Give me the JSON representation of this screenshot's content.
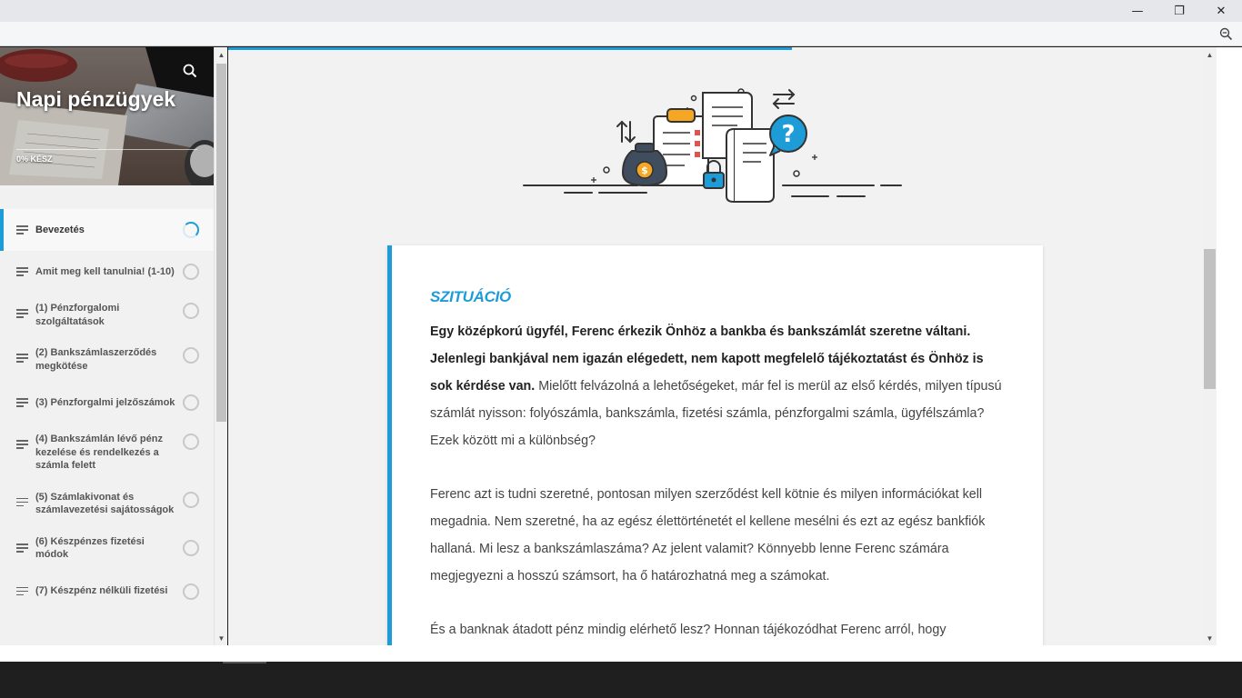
{
  "window": {
    "minimize_glyph": "—",
    "restore_glyph": "❐",
    "close_glyph": "✕"
  },
  "icons": {
    "zoom": "zoom-out-icon",
    "search": "search-icon",
    "menu": "menu-lines-icon"
  },
  "colors": {
    "accent": "#1d9cd8",
    "progress_bar_fraction": 0.57
  },
  "course": {
    "title": "Napi pénzügyek",
    "progress_label": "0% KÉSZ"
  },
  "lessons": [
    {
      "label": "Bevezetés",
      "active": true
    },
    {
      "label": "Amit meg kell tanulnia! (1-10)"
    },
    {
      "label": "(1) Pénzforgalomi szolgáltatások"
    },
    {
      "label": "(2) Bankszámlaszerződés megkötése"
    },
    {
      "label": "(3) Pénzforgalmi jelzőszámok"
    },
    {
      "label": "(4) Bankszámlán lévő pénz kezelése és rendelkezés a számla felett"
    },
    {
      "label": "(5) Számlakivonat és számlavezetési sajátosságok"
    },
    {
      "label": "(6) Készpénzes fizetési módok"
    },
    {
      "label": "(7) Készpénz nélküli fizetési"
    }
  ],
  "content": {
    "heading": "SZITUÁCIÓ",
    "p1_bold": "Egy középkorú ügyfél, Ferenc érkezik Önhöz a bankba és bankszámlát szeretne váltani. Jelenlegi bankjával nem igazán elégedett, nem kapott megfelelő tájékoztatást és Önhöz is sok kérdése van.",
    "p1_rest": " Mielőtt felvázolná a lehetőségeket, már fel is merül az első kérdés, milyen típusú számlát nyisson: folyószámla, bankszámla, fizetési számla, pénzforgalmi számla, ügyfélszámla? Ezek között mi a különbség?",
    "p2": "Ferenc azt is tudni szeretné, pontosan milyen szerződést kell kötnie és milyen információkat kell megadnia. Nem szeretné, ha az egész élettörténetét el kellene mesélni és ezt az egész bankfiók hallaná. Mi lesz a bankszámlaszáma? Az jelent valamit? Könnyebb lenne Ferenc számára megjegyezni a hosszú számsort, ha ő határozhatná meg a számokat.",
    "p3": "És a banknak átadott pénz mindig elérhető lesz? Honnan tájékozódhat Ferenc arról, hogy"
  }
}
